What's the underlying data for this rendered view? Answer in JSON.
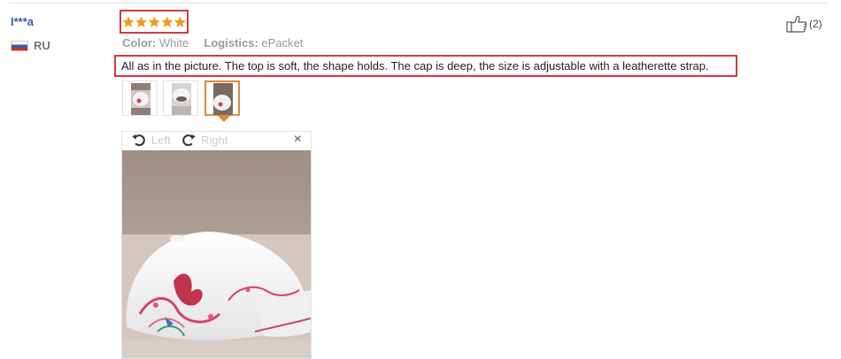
{
  "review": {
    "reviewer_name": "I***a",
    "country": "RU",
    "rating": 5,
    "rating_max": 5,
    "meta": {
      "color_label": "Color:",
      "color_value": "White",
      "logistics_label": "Logistics:",
      "logistics_value": "ePacket"
    },
    "text": "All as in the picture. The top is soft, the shape holds. The cap is deep, the size is adjustable with a leatherette strap.",
    "thumbnails": [
      {
        "selected": false
      },
      {
        "selected": false
      },
      {
        "selected": true
      }
    ],
    "viewer": {
      "rotate_left_label": "Left",
      "rotate_right_label": "Right",
      "close_glyph": "×"
    },
    "helpful": {
      "count_label": "(2)",
      "icon": "thumbs-up-icon"
    }
  },
  "colors": {
    "highlight_border": "#d43a3a",
    "star": "#f39a16",
    "selected_thumb": "#e1893a",
    "reviewer_link": "#2c5fb0"
  }
}
